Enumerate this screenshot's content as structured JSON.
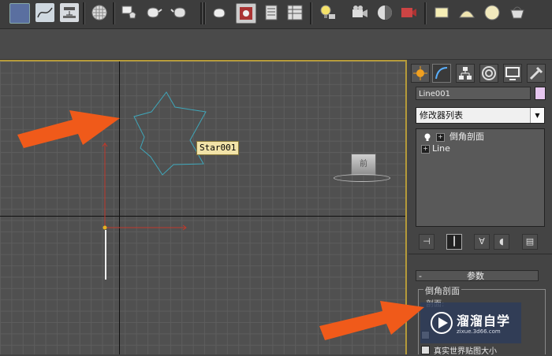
{
  "toolbar": {
    "icons": [
      "select-filter-icon",
      "curve-editor-icon",
      "schematic-view-icon",
      "material-editor-icon",
      "render-setup-icon",
      "rendered-frame-icon",
      "render-icon",
      "teapot-icon",
      "render-frame-window-icon",
      "layer-manager-icon",
      "scene-explorer-icon",
      "light-icon",
      "camera-icon",
      "helper-icon",
      "space-warp-icon",
      "box-icon",
      "dome-icon",
      "sphere-icon",
      "basket-icon"
    ]
  },
  "viewport": {
    "selected_object_label": "Star001",
    "viewcube_face": "前"
  },
  "command_panel": {
    "object_name": "Line001",
    "object_color": "#e6c6ef",
    "modifier_list_label": "修改器列表",
    "modifier_stack": [
      {
        "label": "倒角剖面",
        "has_light_icon": true
      },
      {
        "label": "Line",
        "has_light_icon": false
      }
    ],
    "rollout": {
      "collapse_symbol": "-",
      "title": "参数"
    },
    "group_label": "倒角剖面",
    "sub_label": "剖面:",
    "checkbox_real_world_label": "真实世界贴图大小"
  },
  "watermark": {
    "text": "溜溜自学",
    "url": "zixue.3d66.com"
  },
  "colors": {
    "viewport_bg": "#505050",
    "grid_line": "#5d5d5d",
    "star_shape": "#3fa6b9",
    "red_axis": "#c0392b",
    "arrow": "#f05a1a",
    "active_border": "#b59a3a"
  }
}
